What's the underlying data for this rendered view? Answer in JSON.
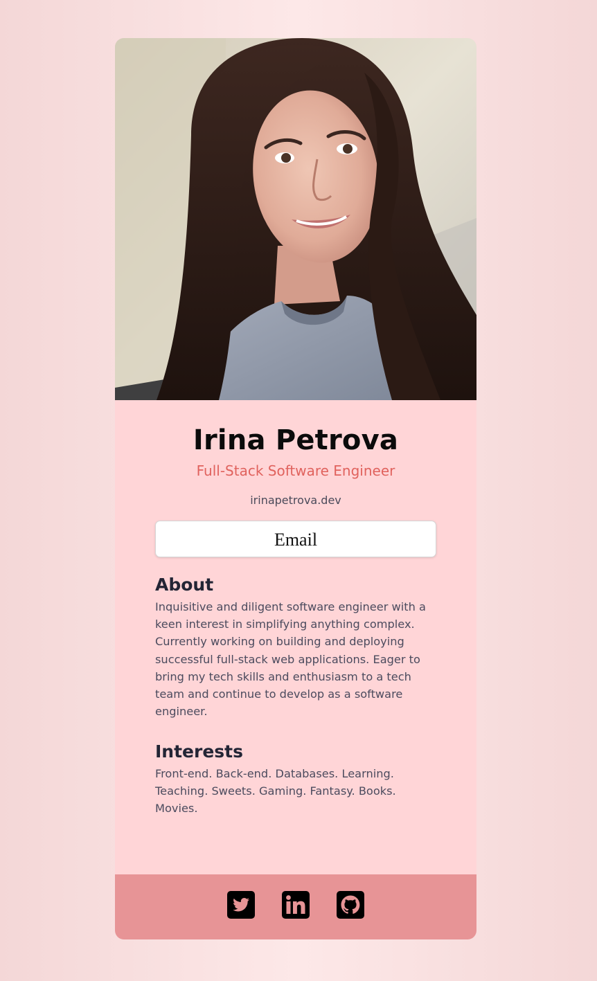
{
  "profile": {
    "name": "Irina Petrova",
    "title": "Full-Stack Software Engineer",
    "website": "irinapetrova.dev",
    "email_label": "Email",
    "photo_icon": "profile-photo"
  },
  "about": {
    "heading": "About",
    "text": "Inquisitive and diligent software engineer with a keen interest in simplifying anything complex. Currently working on building and deploying successful full-stack web applications. Eager to bring my tech skills and enthusiasm to a tech team and continue to develop as a software engineer."
  },
  "interests": {
    "heading": "Interests",
    "text": "Front-end. Back-end. Databases. Learning. Teaching. Sweets. Gaming. Fantasy. Books. Movies."
  },
  "social": [
    {
      "icon": "twitter-icon"
    },
    {
      "icon": "linkedin-icon"
    },
    {
      "icon": "github-icon"
    }
  ],
  "colors": {
    "card_bg": "#ffd5d7",
    "accent": "#e0625d",
    "footer_bg": "#e79496",
    "heading": "#232535"
  }
}
